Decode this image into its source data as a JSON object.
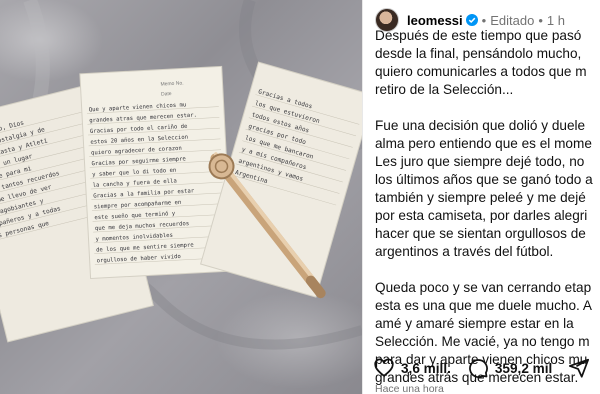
{
  "post": {
    "username": "leomessi",
    "separator": "•",
    "edited": "Editado",
    "age": "1 h",
    "caption": [
      "Después de este tiempo que pasó\ndesde la final, pensándolo mucho,\nquiero comunicarles a todos que m\nretiro de la Selección...",
      "Fue una decisión que dolió y duele\nalma pero entiendo que es el mome\nLes juro que siempre dejé todo, no\nlos últimos años que se ganó todo a\ntambién y siempre peleé y me dejé\npor esta camiseta, por darles alegri\nhacer que se sientan orgullosos de\nargentinos a través del fútbol.",
      "Queda poco y se van cerrando etap\nesta es una que me duele mucho. A\namé y amaré siempre estar en la\nSelección. Me vacié, ya no tengo m\npara dar y aparte vienen chicos mu\ngrandes atrás que merecen estar."
    ],
    "likes": "3,6 mill.",
    "comments": "359,2 mil",
    "timestamp": "Hace una hora",
    "icons": {
      "like": "heart-icon",
      "comment": "comment-icon",
      "share": "share-icon",
      "verified": "verified-badge-icon"
    }
  },
  "photo": {
    "notes_left": [
      "Q esfuerzo, Dios",
      "Sin la nostalgia y de",
      "a su Canasta y Atleti",
      "Ha Sido un lugar",
      "siempre para mi",
      "y son tantos recuerdos",
      "que me llevo de ver",
      "los agobiantes y",
      "compañeros y a todas",
      "las personas que"
    ],
    "notes_center": [
      "Que y aparte vienen chicos mu",
      "grandes atras que merecen estar.",
      "Gracias por todo el cariño de",
      "estos 20 años en la Seleccion",
      "quiero agradecer de corazon",
      "Gracias por seguirme siempre",
      "y saber que lo di todo en",
      "la cancha y fuera de ella",
      "Gracias a la familia por estar",
      "siempre por acompañarme en",
      "este sueño que terminó y",
      "que me deja muchos recuerdos",
      "y momentos inolvidables",
      "de los que me sentire siempre",
      "orgulloso de haber vivido"
    ],
    "notes_right": [
      "Gracias a todos",
      "los que estuvieron",
      "todos estos años",
      "gracias por todo",
      "los que me bancaron",
      "y a mis compañeros",
      "argentinos y vamos",
      "Argentina"
    ],
    "notebook_headers": [
      "Memo No.",
      "Date"
    ]
  }
}
